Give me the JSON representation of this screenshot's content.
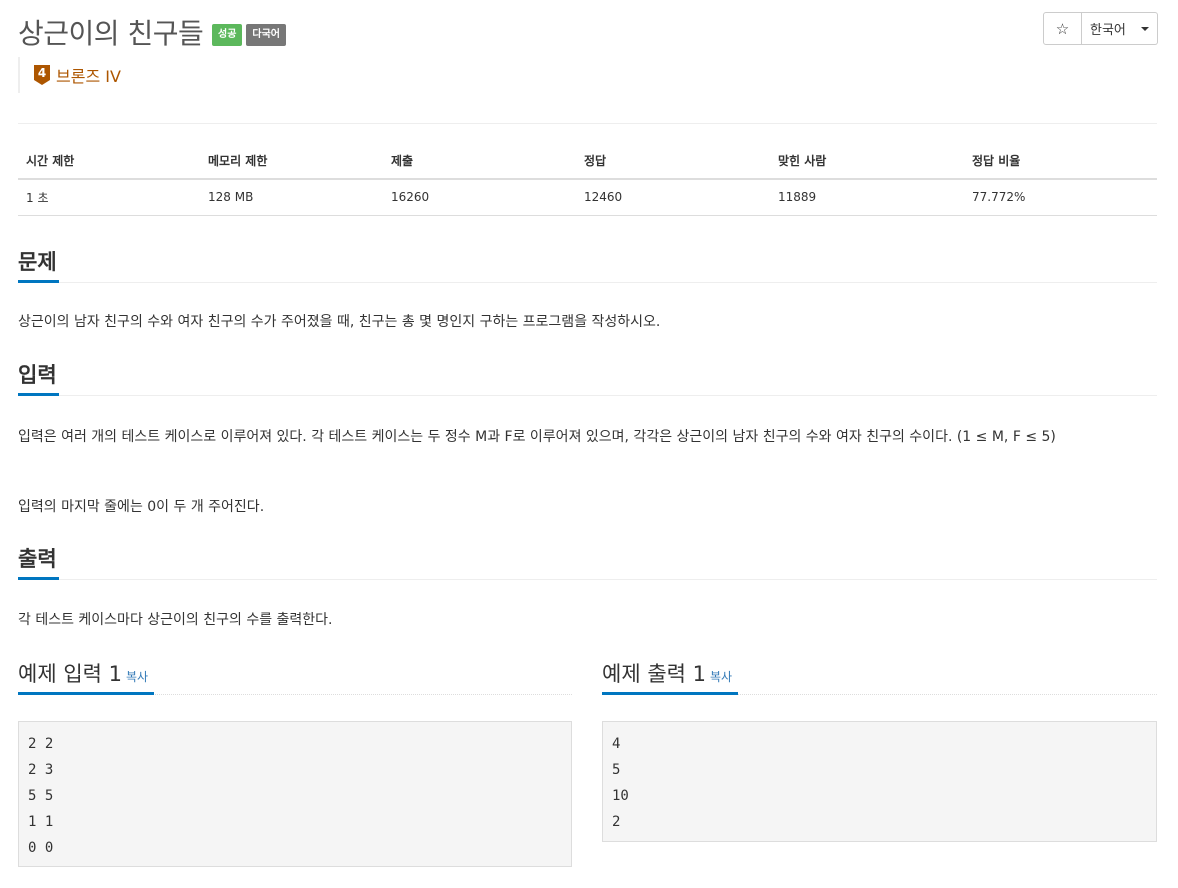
{
  "problem": {
    "title": "상근이의 친구들",
    "badges": {
      "success": "성공",
      "multilang": "다국어"
    },
    "tier": {
      "level": "4",
      "label": "브론즈 IV",
      "color": "#ad5600"
    }
  },
  "toolbar": {
    "star": "☆",
    "language": "한국어"
  },
  "info_table": {
    "headers": [
      "시간 제한",
      "메모리 제한",
      "제출",
      "정답",
      "맞힌 사람",
      "정답 비율"
    ],
    "values": [
      "1 초",
      "128 MB",
      "16260",
      "12460",
      "11889",
      "77.772%"
    ]
  },
  "sections": {
    "description": {
      "title": "문제",
      "text": "상근이의 남자 친구의 수와 여자 친구의 수가 주어졌을 때, 친구는 총 몇 명인지 구하는 프로그램을 작성하시오."
    },
    "input": {
      "title": "입력",
      "text1": "입력은 여러 개의 테스트 케이스로 이루어져 있다. 각 테스트 케이스는 두 정수 M과 F로 이루어져 있으며, 각각은 상근이의 남자 친구의 수와 여자 친구의 수이다. (1 ≤ M, F ≤ 5)",
      "text2": "입력의 마지막 줄에는 0이 두 개 주어진다."
    },
    "output": {
      "title": "출력",
      "text": "각 테스트 케이스마다 상근이의 친구의 수를 출력한다."
    }
  },
  "samples": {
    "input": {
      "title": "예제 입력 1",
      "copy": "복사",
      "content": "2 2\n2 3\n5 5\n1 1\n0 0"
    },
    "output": {
      "title": "예제 출력 1",
      "copy": "복사",
      "content": "4\n5\n10\n2"
    }
  },
  "colors": {
    "accent": "#0076c0",
    "success": "#5cb85c",
    "link": "#337ab7"
  }
}
